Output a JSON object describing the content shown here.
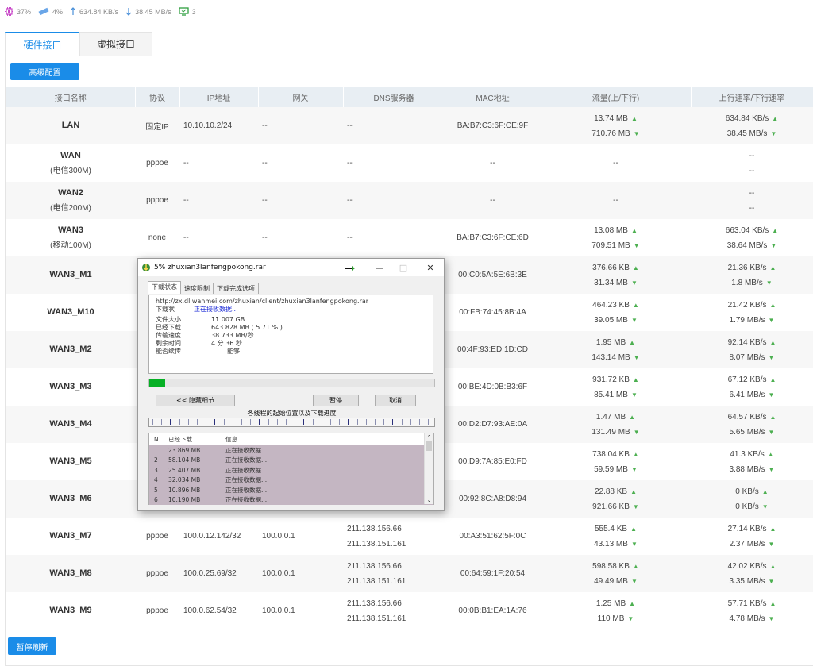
{
  "status": {
    "cpu": "37%",
    "mem": "4%",
    "up": "634.84 KB/s",
    "down": "38.45 MB/s",
    "online": "3"
  },
  "tabs": [
    "硬件接口",
    "虚拟接口"
  ],
  "adv_btn": "高级配置",
  "pause_refresh": "暂停刷新",
  "headers": [
    "接口名称",
    "协议",
    "IP地址",
    "网关",
    "DNS服务器",
    "MAC地址",
    "流量(上/下行)",
    "上行速率/下行速率"
  ],
  "rows": [
    {
      "name": "LAN",
      "sub": "",
      "proto": "固定IP",
      "ip": "10.10.10.2/24",
      "gw": "--",
      "dns1": "--",
      "dns2": "",
      "mac": "BA:B7:C3:6F:CE:9F",
      "tu": "13.74 MB",
      "td": "710.76 MB",
      "ru": "634.84 KB/s",
      "rd": "38.45 MB/s",
      "arrows": true
    },
    {
      "name": "WAN",
      "sub": "(电信300M)",
      "proto": "pppoe",
      "ip": "--",
      "gw": "--",
      "dns1": "--",
      "dns2": "",
      "mac": "--",
      "tu": "--",
      "td": "",
      "ru": "--",
      "rd": "--",
      "arrows": false
    },
    {
      "name": "WAN2",
      "sub": "(电信200M)",
      "proto": "pppoe",
      "ip": "--",
      "gw": "--",
      "dns1": "--",
      "dns2": "",
      "mac": "--",
      "tu": "--",
      "td": "",
      "ru": "--",
      "rd": "--",
      "arrows": false
    },
    {
      "name": "WAN3",
      "sub": "(移动100M)",
      "proto": "none",
      "ip": "--",
      "gw": "--",
      "dns1": "--",
      "dns2": "",
      "mac": "BA:B7:C3:6F:CE:6D",
      "tu": "13.08 MB",
      "td": "709.51 MB",
      "ru": "663.04 KB/s",
      "rd": "38.64 MB/s",
      "arrows": true
    },
    {
      "name": "WAN3_M1",
      "sub": "",
      "proto": "",
      "ip": "",
      "gw": "",
      "dns1": "",
      "dns2": "",
      "mac": "00:C0:5A:5E:6B:3E",
      "tu": "376.66 KB",
      "td": "31.34 MB",
      "ru": "21.36 KB/s",
      "rd": "1.8 MB/s",
      "arrows": true
    },
    {
      "name": "WAN3_M10",
      "sub": "",
      "proto": "",
      "ip": "",
      "gw": "",
      "dns1": "",
      "dns2": "",
      "mac": "00:FB:74:45:8B:4A",
      "tu": "464.23 KB",
      "td": "39.05 MB",
      "ru": "21.42 KB/s",
      "rd": "1.79 MB/s",
      "arrows": true
    },
    {
      "name": "WAN3_M2",
      "sub": "",
      "proto": "",
      "ip": "",
      "gw": "",
      "dns1": "",
      "dns2": "",
      "mac": "00:4F:93:ED:1D:CD",
      "tu": "1.95 MB",
      "td": "143.14 MB",
      "ru": "92.14 KB/s",
      "rd": "8.07 MB/s",
      "arrows": true
    },
    {
      "name": "WAN3_M3",
      "sub": "",
      "proto": "",
      "ip": "",
      "gw": "",
      "dns1": "",
      "dns2": "",
      "mac": "00:BE:4D:0B:B3:6F",
      "tu": "931.72 KB",
      "td": "85.41 MB",
      "ru": "67.12 KB/s",
      "rd": "6.41 MB/s",
      "arrows": true
    },
    {
      "name": "WAN3_M4",
      "sub": "",
      "proto": "",
      "ip": "",
      "gw": "",
      "dns1": "",
      "dns2": "",
      "mac": "00:D2:D7:93:AE:0A",
      "tu": "1.47 MB",
      "td": "131.49 MB",
      "ru": "64.57 KB/s",
      "rd": "5.65 MB/s",
      "arrows": true
    },
    {
      "name": "WAN3_M5",
      "sub": "",
      "proto": "",
      "ip": "",
      "gw": "",
      "dns1": "",
      "dns2": "",
      "mac": "00:D9:7A:85:E0:FD",
      "tu": "738.04 KB",
      "td": "59.59 MB",
      "ru": "41.3 KB/s",
      "rd": "3.88 MB/s",
      "arrows": true
    },
    {
      "name": "WAN3_M6",
      "sub": "",
      "proto": "",
      "ip": "",
      "gw": "",
      "dns1": "",
      "dns2": "",
      "mac": "00:92:8C:A8:D8:94",
      "tu": "22.88 KB",
      "td": "921.66 KB",
      "ru": "0 KB/s",
      "rd": "0 KB/s",
      "arrows": true
    },
    {
      "name": "WAN3_M7",
      "sub": "",
      "proto": "pppoe",
      "ip": "100.0.12.142/32",
      "gw": "100.0.0.1",
      "dns1": "211.138.156.66",
      "dns2": "211.138.151.161",
      "mac": "00:A3:51:62:5F:0C",
      "tu": "555.4 KB",
      "td": "43.13 MB",
      "ru": "27.14 KB/s",
      "rd": "2.37 MB/s",
      "arrows": true
    },
    {
      "name": "WAN3_M8",
      "sub": "",
      "proto": "pppoe",
      "ip": "100.0.25.69/32",
      "gw": "100.0.0.1",
      "dns1": "211.138.156.66",
      "dns2": "211.138.151.161",
      "mac": "00:64:59:1F:20:54",
      "tu": "598.58 KB",
      "td": "49.49 MB",
      "ru": "42.02 KB/s",
      "rd": "3.35 MB/s",
      "arrows": true
    },
    {
      "name": "WAN3_M9",
      "sub": "",
      "proto": "pppoe",
      "ip": "100.0.62.54/32",
      "gw": "100.0.0.1",
      "dns1": "211.138.156.66",
      "dns2": "211.138.151.161",
      "mac": "00:0B:B1:EA:1A:76",
      "tu": "1.25 MB",
      "td": "110 MB",
      "ru": "57.71 KB/s",
      "rd": "4.78 MB/s",
      "arrows": true
    }
  ],
  "dialog": {
    "title": "5% zhuxian3lanfengpokong.rar",
    "tabs": [
      "下载状态",
      "速度限制",
      "下载完成选项"
    ],
    "url": "http://zx.dl.wanmei.com/zhuxian/client/zhuxian3lanfengpokong.rar",
    "status_label": "下载状",
    "status_value": "正在接收数据...",
    "fields": [
      {
        "k": "文件大小",
        "v": "11.007  GB"
      },
      {
        "k": "已经下载",
        "v": "643.828  MB  ( 5.71 % )"
      },
      {
        "k": "传输速度",
        "v": "38.733  MB/秒"
      },
      {
        "k": "剩余时间",
        "v": "4 分 36 秒"
      },
      {
        "k": "能否续传",
        "v": "能够"
      }
    ],
    "progress": 0.0571,
    "hide_btn": "<< 隐藏细节",
    "pause_btn": "暂停",
    "cancel_btn": "取消",
    "segments_label": "各线程的起始位置以及下载进度",
    "list_headers": [
      "N.",
      "已经下载",
      "信息"
    ],
    "threads": [
      {
        "n": "1",
        "d": "23.869 MB",
        "i": "正在接收数据..."
      },
      {
        "n": "2",
        "d": "58.104 MB",
        "i": "正在接收数据..."
      },
      {
        "n": "3",
        "d": "25.407 MB",
        "i": "正在接收数据..."
      },
      {
        "n": "4",
        "d": "32.034 MB",
        "i": "正在接收数据..."
      },
      {
        "n": "5",
        "d": "10.896 MB",
        "i": "正在接收数据..."
      },
      {
        "n": "6",
        "d": "10.190 MB",
        "i": "正在接收数据..."
      }
    ]
  }
}
